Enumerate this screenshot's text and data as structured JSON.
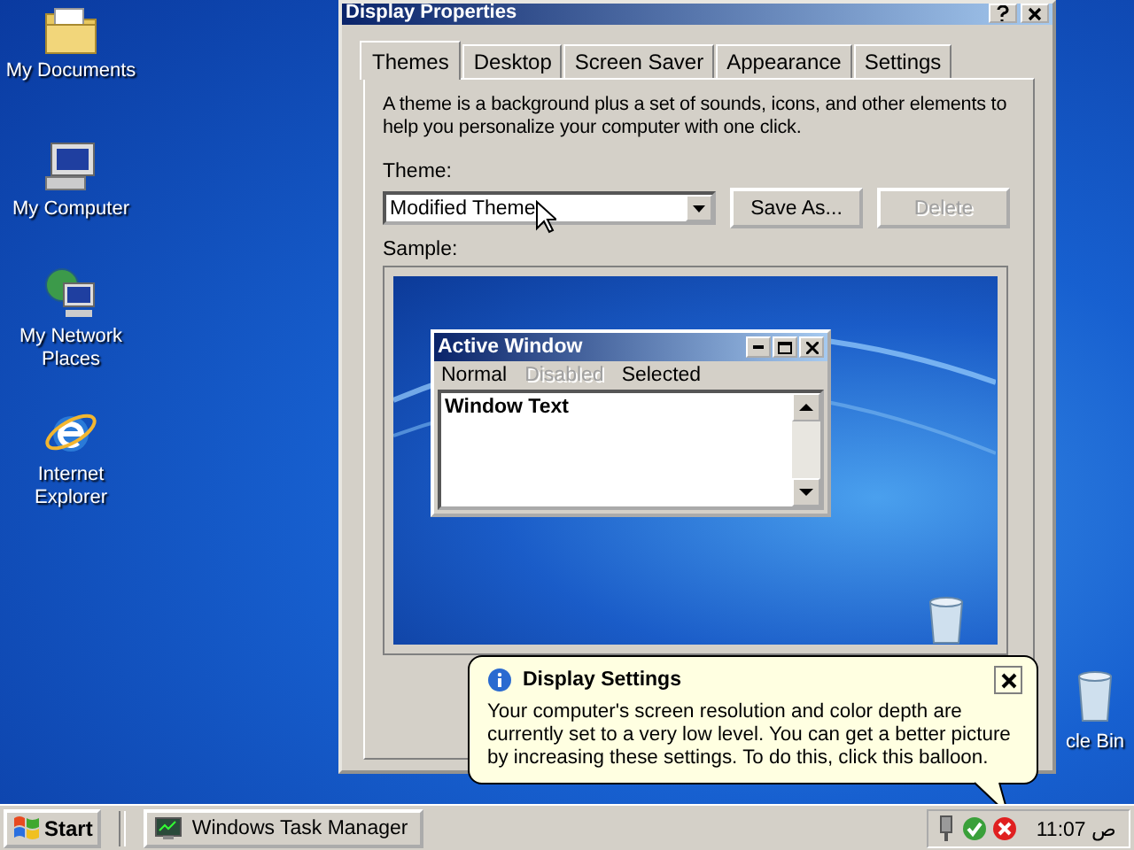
{
  "desktop_icons": [
    {
      "label": "My Documents",
      "kind": "folder"
    },
    {
      "label": "My Computer",
      "kind": "computer"
    },
    {
      "label": "My Network Places",
      "kind": "network"
    },
    {
      "label": "Internet Explorer",
      "kind": "browser"
    }
  ],
  "desktop_partial_label": "cle Bin",
  "dialog": {
    "title": "Display Properties",
    "tabs": [
      {
        "label": "Themes",
        "selected": true
      },
      {
        "label": "Desktop",
        "selected": false
      },
      {
        "label": "Screen Saver",
        "selected": false
      },
      {
        "label": "Appearance",
        "selected": false
      },
      {
        "label": "Settings",
        "selected": false
      }
    ],
    "description": "A theme is a background plus a set of sounds, icons, and other elements to help you personalize your computer with one click.",
    "theme_label": "Theme:",
    "theme_value": "Modified Theme",
    "buttons": [
      {
        "label": "Save As...",
        "disabled": false
      },
      {
        "label": "Delete",
        "disabled": true
      }
    ],
    "sample_label": "Sample:",
    "sample_window": {
      "title": "Active Window",
      "menu": [
        {
          "label": "Normal",
          "disabled": false
        },
        {
          "label": "Disabled",
          "disabled": true
        },
        {
          "label": "Selected",
          "disabled": false
        }
      ],
      "text": "Window Text"
    }
  },
  "balloon": {
    "title": "Display Settings",
    "message": "Your computer's screen resolution and color depth are currently set to a very low level. You can get a better picture by increasing these settings. To do this, click this balloon."
  },
  "taskbar": {
    "start": "Start",
    "tasks": [
      {
        "label": "Windows Task Manager"
      }
    ],
    "clock": "11:07 ص"
  }
}
